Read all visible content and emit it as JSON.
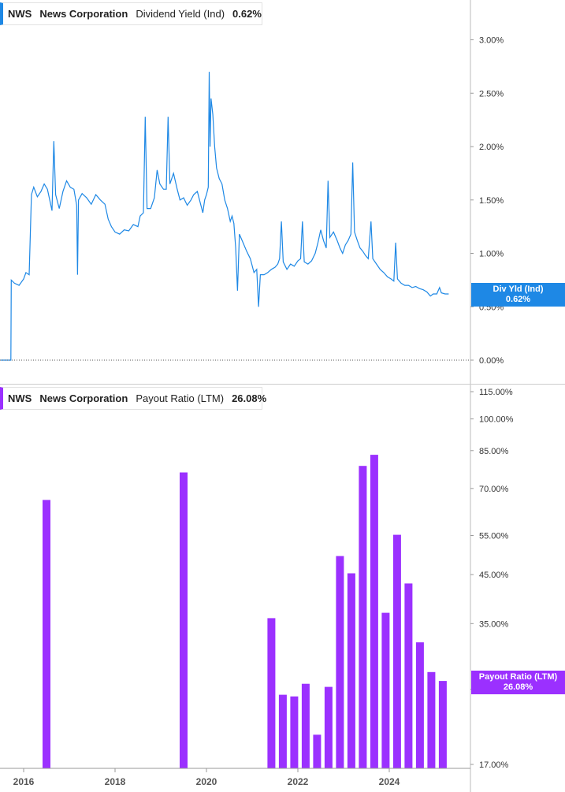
{
  "top_legend": {
    "ticker": "NWS",
    "company": "News Corporation",
    "metric": "Dividend Yield (Ind)",
    "value": "0.62%"
  },
  "bottom_legend": {
    "ticker": "NWS",
    "company": "News Corporation",
    "metric": "Payout Ratio (LTM)",
    "value": "26.08%"
  },
  "top_tag": {
    "line1": "Div Yld (Ind)",
    "line2": "0.62%"
  },
  "bottom_tag": {
    "line1": "Payout Ratio (LTM)",
    "line2": "26.08%"
  },
  "colors": {
    "yield_line": "#1e88e5",
    "payout_bars": "#9b30ff",
    "tag_blue": "#1e88e5",
    "tag_purple": "#9b30ff"
  },
  "chart_data": [
    {
      "type": "line",
      "series": [
        {
          "name": "Dividend Yield (Ind)",
          "values": [
            [
              2015.5,
              0.0
            ],
            [
              2015.72,
              0.0
            ],
            [
              2015.73,
              0.75
            ],
            [
              2015.8,
              0.72
            ],
            [
              2015.9,
              0.7
            ],
            [
              2016.0,
              0.76
            ],
            [
              2016.05,
              0.82
            ],
            [
              2016.12,
              0.8
            ],
            [
              2016.17,
              1.55
            ],
            [
              2016.22,
              1.62
            ],
            [
              2016.3,
              1.53
            ],
            [
              2016.38,
              1.58
            ],
            [
              2016.45,
              1.65
            ],
            [
              2016.52,
              1.6
            ],
            [
              2016.62,
              1.4
            ],
            [
              2016.66,
              2.05
            ],
            [
              2016.7,
              1.55
            ],
            [
              2016.78,
              1.42
            ],
            [
              2016.86,
              1.58
            ],
            [
              2016.94,
              1.68
            ],
            [
              2017.02,
              1.62
            ],
            [
              2017.1,
              1.6
            ],
            [
              2017.16,
              1.45
            ],
            [
              2017.18,
              0.8
            ],
            [
              2017.2,
              1.5
            ],
            [
              2017.28,
              1.56
            ],
            [
              2017.38,
              1.52
            ],
            [
              2017.48,
              1.46
            ],
            [
              2017.58,
              1.55
            ],
            [
              2017.68,
              1.5
            ],
            [
              2017.78,
              1.46
            ],
            [
              2017.85,
              1.32
            ],
            [
              2017.92,
              1.25
            ],
            [
              2018.0,
              1.2
            ],
            [
              2018.1,
              1.18
            ],
            [
              2018.2,
              1.22
            ],
            [
              2018.3,
              1.21
            ],
            [
              2018.4,
              1.27
            ],
            [
              2018.5,
              1.25
            ],
            [
              2018.55,
              1.35
            ],
            [
              2018.62,
              1.38
            ],
            [
              2018.66,
              2.28
            ],
            [
              2018.7,
              1.42
            ],
            [
              2018.78,
              1.42
            ],
            [
              2018.86,
              1.52
            ],
            [
              2018.92,
              1.78
            ],
            [
              2018.98,
              1.65
            ],
            [
              2019.06,
              1.6
            ],
            [
              2019.12,
              1.6
            ],
            [
              2019.16,
              2.28
            ],
            [
              2019.2,
              1.65
            ],
            [
              2019.28,
              1.75
            ],
            [
              2019.36,
              1.6
            ],
            [
              2019.42,
              1.5
            ],
            [
              2019.5,
              1.52
            ],
            [
              2019.58,
              1.45
            ],
            [
              2019.66,
              1.5
            ],
            [
              2019.72,
              1.55
            ],
            [
              2019.8,
              1.58
            ],
            [
              2019.86,
              1.48
            ],
            [
              2019.92,
              1.38
            ],
            [
              2019.96,
              1.5
            ],
            [
              2020.0,
              1.55
            ],
            [
              2020.04,
              1.62
            ],
            [
              2020.06,
              2.7
            ],
            [
              2020.08,
              2.0
            ],
            [
              2020.1,
              2.45
            ],
            [
              2020.14,
              2.3
            ],
            [
              2020.18,
              2.0
            ],
            [
              2020.22,
              1.8
            ],
            [
              2020.28,
              1.7
            ],
            [
              2020.34,
              1.65
            ],
            [
              2020.4,
              1.5
            ],
            [
              2020.46,
              1.42
            ],
            [
              2020.52,
              1.3
            ],
            [
              2020.56,
              1.35
            ],
            [
              2020.6,
              1.28
            ],
            [
              2020.64,
              1.05
            ],
            [
              2020.68,
              0.65
            ],
            [
              2020.72,
              1.18
            ],
            [
              2020.8,
              1.1
            ],
            [
              2020.88,
              1.02
            ],
            [
              2020.96,
              0.95
            ],
            [
              2021.04,
              0.82
            ],
            [
              2021.1,
              0.85
            ],
            [
              2021.14,
              0.5
            ],
            [
              2021.18,
              0.8
            ],
            [
              2021.26,
              0.8
            ],
            [
              2021.34,
              0.82
            ],
            [
              2021.42,
              0.85
            ],
            [
              2021.5,
              0.87
            ],
            [
              2021.56,
              0.9
            ],
            [
              2021.6,
              0.95
            ],
            [
              2021.64,
              1.3
            ],
            [
              2021.68,
              0.92
            ],
            [
              2021.76,
              0.85
            ],
            [
              2021.84,
              0.9
            ],
            [
              2021.92,
              0.88
            ],
            [
              2022.0,
              0.93
            ],
            [
              2022.06,
              0.95
            ],
            [
              2022.1,
              1.3
            ],
            [
              2022.14,
              0.92
            ],
            [
              2022.22,
              0.9
            ],
            [
              2022.3,
              0.93
            ],
            [
              2022.38,
              1.0
            ],
            [
              2022.44,
              1.1
            ],
            [
              2022.5,
              1.22
            ],
            [
              2022.56,
              1.12
            ],
            [
              2022.62,
              1.05
            ],
            [
              2022.66,
              1.68
            ],
            [
              2022.7,
              1.15
            ],
            [
              2022.78,
              1.2
            ],
            [
              2022.86,
              1.12
            ],
            [
              2022.92,
              1.05
            ],
            [
              2022.98,
              1.0
            ],
            [
              2023.04,
              1.08
            ],
            [
              2023.1,
              1.12
            ],
            [
              2023.16,
              1.18
            ],
            [
              2023.2,
              1.85
            ],
            [
              2023.24,
              1.2
            ],
            [
              2023.3,
              1.12
            ],
            [
              2023.36,
              1.05
            ],
            [
              2023.42,
              1.02
            ],
            [
              2023.48,
              0.98
            ],
            [
              2023.54,
              0.95
            ],
            [
              2023.6,
              1.3
            ],
            [
              2023.64,
              0.95
            ],
            [
              2023.72,
              0.9
            ],
            [
              2023.8,
              0.85
            ],
            [
              2023.88,
              0.82
            ],
            [
              2023.96,
              0.78
            ],
            [
              2024.04,
              0.76
            ],
            [
              2024.1,
              0.74
            ],
            [
              2024.14,
              1.1
            ],
            [
              2024.18,
              0.76
            ],
            [
              2024.26,
              0.72
            ],
            [
              2024.34,
              0.7
            ],
            [
              2024.42,
              0.7
            ],
            [
              2024.5,
              0.68
            ],
            [
              2024.58,
              0.69
            ],
            [
              2024.66,
              0.67
            ],
            [
              2024.74,
              0.66
            ],
            [
              2024.82,
              0.64
            ],
            [
              2024.9,
              0.6
            ],
            [
              2024.96,
              0.62
            ],
            [
              2025.04,
              0.62
            ],
            [
              2025.1,
              0.68
            ],
            [
              2025.14,
              0.63
            ],
            [
              2025.22,
              0.62
            ],
            [
              2025.3,
              0.62
            ]
          ]
        }
      ],
      "yticks": [
        "0.00%",
        "0.50%",
        "1.00%",
        "1.50%",
        "2.00%",
        "2.50%",
        "3.00%"
      ],
      "ytick_values": [
        0,
        0.5,
        1.0,
        1.5,
        2.0,
        2.5,
        3.0
      ],
      "ylim": [
        0,
        3.2
      ]
    },
    {
      "type": "bar",
      "scale": "log",
      "series": [
        {
          "name": "Payout Ratio (LTM)",
          "values": [
            [
              2016.5,
              66.0
            ],
            [
              2019.5,
              76.0
            ],
            [
              2021.42,
              36.0
            ],
            [
              2021.67,
              24.3
            ],
            [
              2021.92,
              24.1
            ],
            [
              2022.17,
              25.7
            ],
            [
              2022.42,
              19.8
            ],
            [
              2022.67,
              25.3
            ],
            [
              2022.92,
              49.5
            ],
            [
              2023.17,
              45.3
            ],
            [
              2023.42,
              78.6
            ],
            [
              2023.67,
              83.2
            ],
            [
              2023.92,
              37.0
            ],
            [
              2024.17,
              55.2
            ],
            [
              2024.42,
              43.0
            ],
            [
              2024.67,
              31.8
            ],
            [
              2024.92,
              27.3
            ],
            [
              2025.17,
              26.08
            ]
          ]
        }
      ],
      "yticks": [
        "17.00%",
        "25.00%",
        "35.00%",
        "45.00%",
        "55.00%",
        "70.00%",
        "85.00%",
        "100.00%",
        "115.00%"
      ],
      "ytick_values": [
        17,
        25,
        35,
        45,
        55,
        70,
        85,
        100,
        115
      ],
      "ylim": [
        17,
        115
      ]
    }
  ],
  "x_axis": {
    "labels": [
      "2016",
      "2018",
      "2020",
      "2022",
      "2024"
    ],
    "values": [
      2016,
      2018,
      2020,
      2022,
      2024
    ]
  }
}
